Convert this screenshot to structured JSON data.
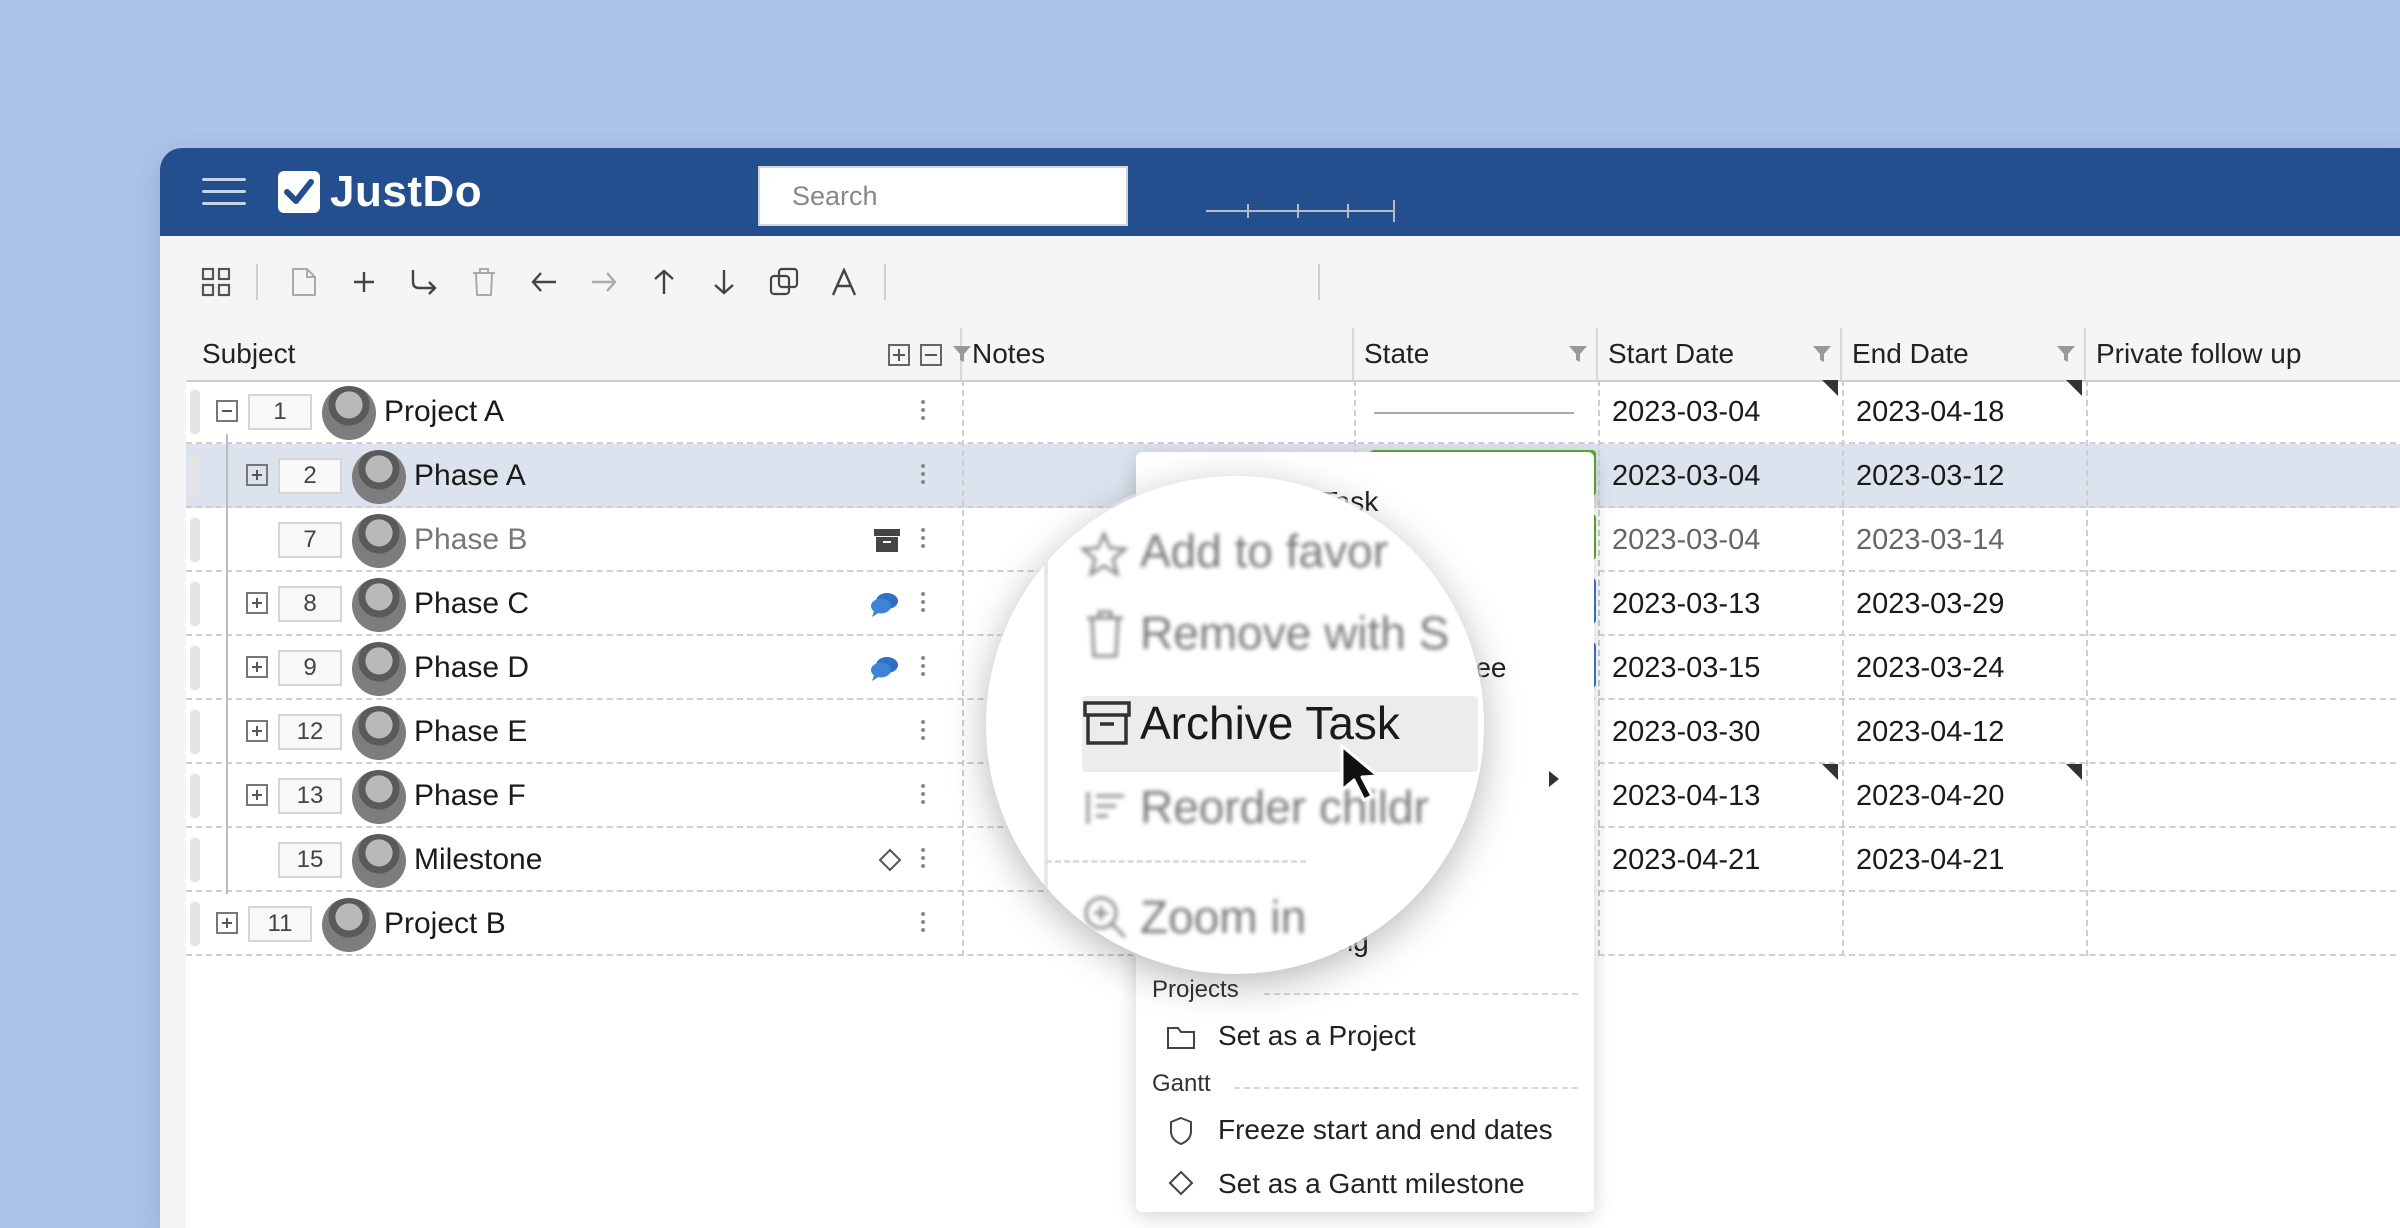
{
  "app": {
    "name": "JustDo"
  },
  "toolbar": {
    "search_placeholder": "Search"
  },
  "columns": [
    {
      "key": "subject",
      "label": "Subject"
    },
    {
      "key": "notes",
      "label": "Notes"
    },
    {
      "key": "state",
      "label": "State"
    },
    {
      "key": "start",
      "label": "Start Date"
    },
    {
      "key": "end",
      "label": "End Date"
    },
    {
      "key": "private",
      "label": "Private follow up"
    }
  ],
  "rows": [
    {
      "seq": "1",
      "subject": "Project A",
      "start": "2023-03-04",
      "end": "2023-04-18",
      "state": "none",
      "expander": "minus",
      "level": 0
    },
    {
      "seq": "2",
      "subject": "Phase A",
      "start": "2023-03-04",
      "end": "2023-03-12",
      "state": "green",
      "expander": "plus",
      "level": 1,
      "selected": true
    },
    {
      "seq": "7",
      "subject": "Phase B",
      "start": "2023-03-04",
      "end": "2023-03-14",
      "state": "green",
      "expander": "none",
      "level": 1,
      "archived": true
    },
    {
      "seq": "8",
      "subject": "Phase C",
      "start": "2023-03-13",
      "end": "2023-03-29",
      "state": "blue",
      "expander": "plus",
      "level": 1,
      "chat": true
    },
    {
      "seq": "9",
      "subject": "Phase D",
      "start": "2023-03-15",
      "end": "2023-03-24",
      "state": "blue",
      "expander": "plus",
      "level": 1,
      "chat": true
    },
    {
      "seq": "12",
      "subject": "Phase E",
      "start": "2023-03-30",
      "end": "2023-04-12",
      "state": "none",
      "expander": "plus",
      "level": 1
    },
    {
      "seq": "13",
      "subject": "Phase F",
      "start": "2023-04-13",
      "end": "2023-04-20",
      "state": "none",
      "expander": "plus",
      "level": 1
    },
    {
      "seq": "15",
      "subject": "Milestone",
      "start": "2023-04-21",
      "end": "2023-04-21",
      "state": "none",
      "expander": "none",
      "level": 1,
      "milestone": true
    },
    {
      "seq": "11",
      "subject": "Project B",
      "start": "",
      "end": "",
      "state": "none",
      "expander": "plus",
      "level": 0
    }
  ],
  "colors": {
    "green": "#5dab34",
    "blue": "#3a7bd0",
    "topbar": "#234f8e"
  },
  "context_menu": {
    "partial_top": "ing Task",
    "partial_tree": "ree",
    "partial_meeting": "eting",
    "projects_header": "Projects",
    "set_project": "Set as a Project",
    "gantt_header": "Gantt",
    "freeze_dates": "Freeze start and end dates",
    "set_milestone": "Set as a Gantt milestone"
  },
  "magnifier": {
    "add_favorites": "Add to favor",
    "remove_with": "Remove with S",
    "archive_task": "Archive Task",
    "reorder_children": "Reorder childr",
    "zoom_in": "Zoom in"
  }
}
